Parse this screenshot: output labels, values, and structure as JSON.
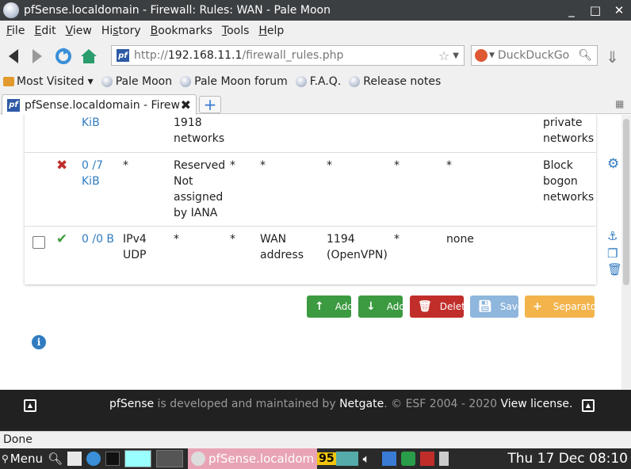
{
  "window": {
    "title": "pfSense.localdomain - Firewall: Rules: WAN - Pale Moon",
    "minimize": "_",
    "maximize": "□",
    "close": "✕"
  },
  "menu": [
    {
      "label": "File",
      "accel": "F"
    },
    {
      "label": "Edit",
      "accel": "E"
    },
    {
      "label": "View",
      "accel": "V"
    },
    {
      "label": "History",
      "accel": "s"
    },
    {
      "label": "Bookmarks",
      "accel": "B"
    },
    {
      "label": "Tools",
      "accel": "T"
    },
    {
      "label": "Help",
      "accel": "H"
    }
  ],
  "nav": {
    "url_prefix": "http://",
    "url_host": "192.168.11.1",
    "url_path": "/firewall_rules.php",
    "search_placeholder": "DuckDuckGo"
  },
  "bookmarks": [
    {
      "label": "Most Visited ▾",
      "icon": "folder-icon"
    },
    {
      "label": "Pale Moon",
      "icon": "globe-icon"
    },
    {
      "label": "Pale Moon forum",
      "icon": "globe-icon"
    },
    {
      "label": "F.A.Q.",
      "icon": "globe-icon"
    },
    {
      "label": "Release notes",
      "icon": "globe-icon"
    }
  ],
  "tab": {
    "label": "pfSense.localdomain - Firew…",
    "site_icon": "pf"
  },
  "rules": {
    "partial_row": {
      "states_unit": "KiB",
      "source_line1": "1918",
      "source_line2": "networks",
      "desc_line1": "private",
      "desc_line2": "networks"
    },
    "bogon_row": {
      "states_line1": "0 /7",
      "states_line2": "KiB",
      "protocol": "*",
      "source_lines": [
        "Reserved",
        "Not",
        "assigned",
        "by IANA"
      ],
      "port": "*",
      "destination": "*",
      "dest_port": "*",
      "gateway": "*",
      "queue": "*",
      "desc_lines": [
        "Block",
        "bogon",
        "networks"
      ]
    },
    "openvpn_row": {
      "states": "0 /0 B",
      "protocol_line1": "IPv4",
      "protocol_line2": "UDP",
      "source": "*",
      "port": "*",
      "destination_line1": "WAN",
      "destination_line2": "address",
      "dest_port_line1": "1194",
      "dest_port_line2": "(OpenVPN)",
      "gateway": "*",
      "queue": "none"
    }
  },
  "buttons": {
    "add_top": "Add",
    "add_bottom": "Add",
    "delete": "Delete",
    "save": "Save",
    "separator": "Separator"
  },
  "footer": {
    "brand": "pfSense",
    "mid": " is developed and maintained by ",
    "company": "Netgate",
    "copy": ". © ESF 2004 - 2020 ",
    "license": "View license."
  },
  "status": "Done",
  "taskbar": {
    "menu": "Menu",
    "window_label": "pfSense.localdom",
    "badge": "95",
    "clock": "Thu 17 Dec 08:10"
  }
}
